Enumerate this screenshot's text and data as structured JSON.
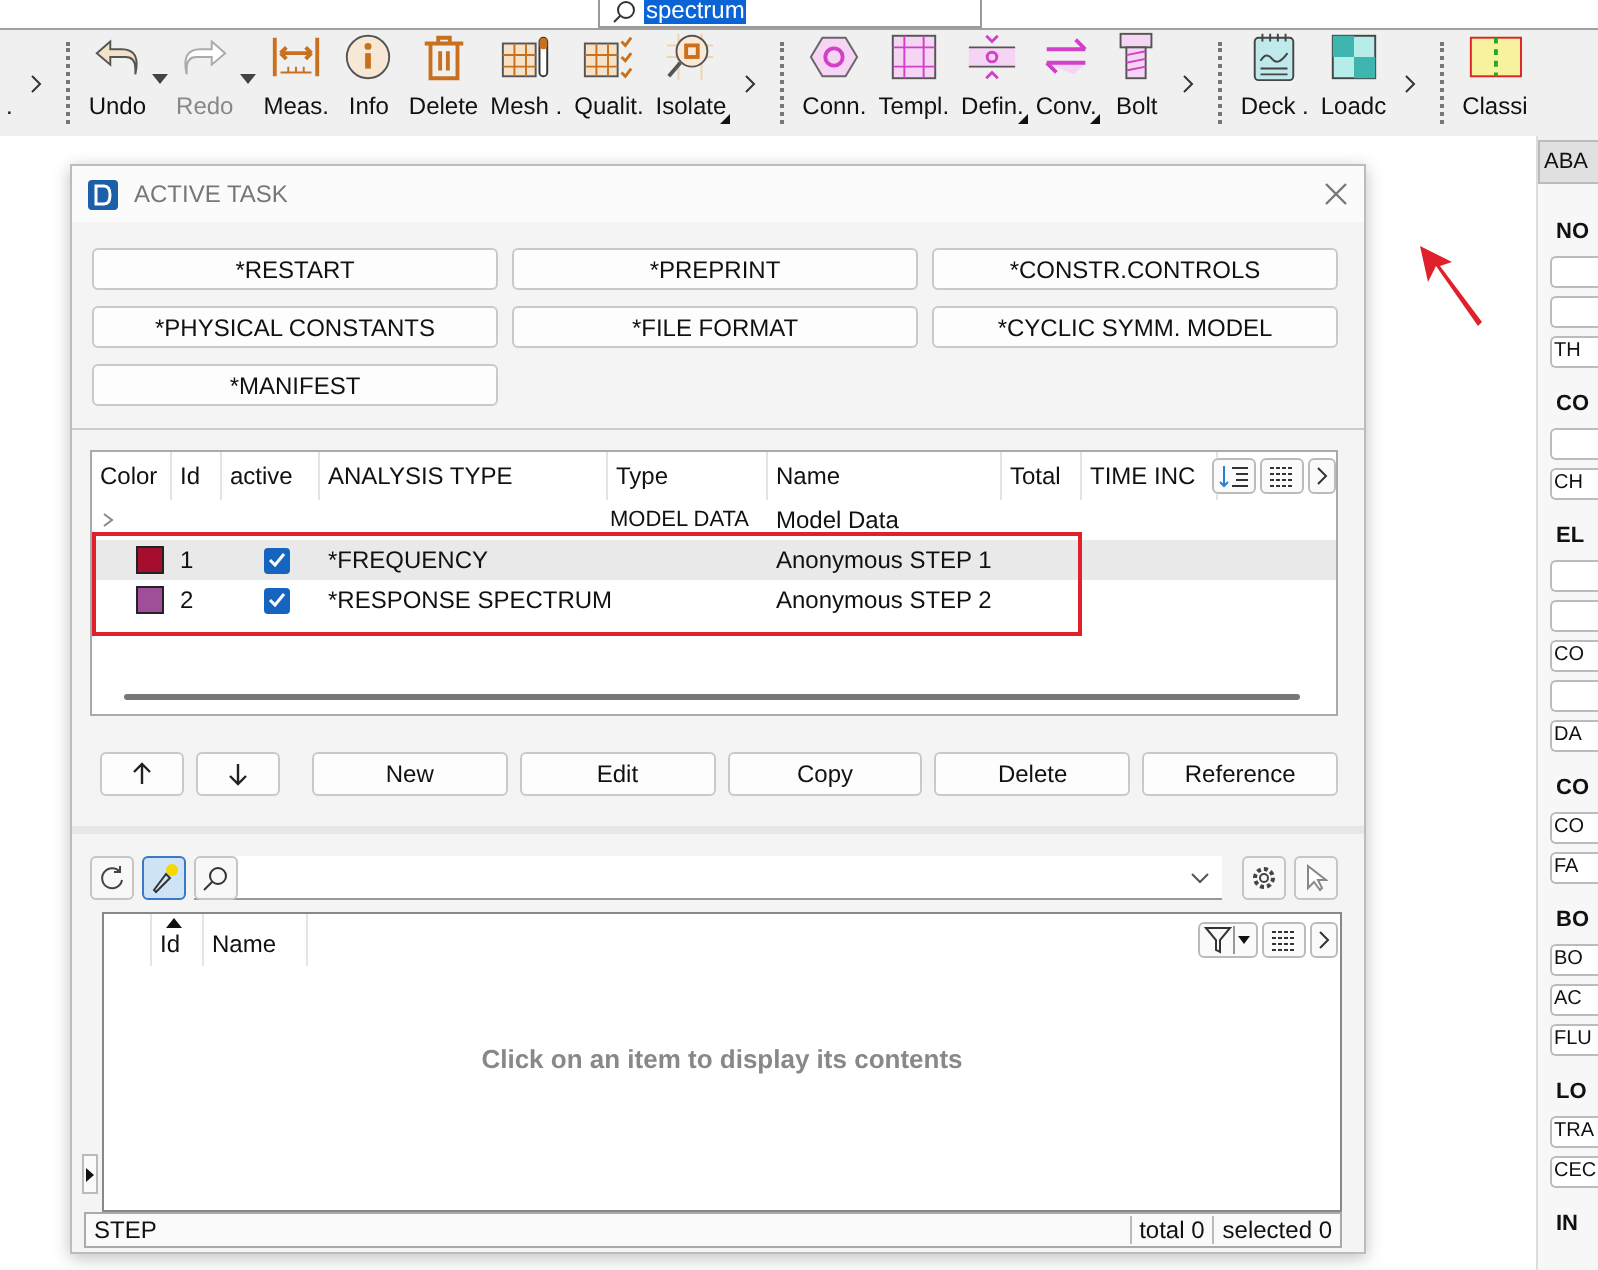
{
  "search": {
    "value": "spectrum",
    "selected": true
  },
  "toolbar": {
    "groups": [
      {
        "overflow": true,
        "items": [
          {
            "kind": "blank",
            "label": ".",
            "disabled": false,
            "side_menu": false,
            "corner_menu": false
          }
        ]
      },
      {
        "overflow": true,
        "items": [
          {
            "kind": "undo",
            "label": "Undo",
            "disabled": false,
            "side_menu": true,
            "corner_menu": false
          },
          {
            "kind": "redo",
            "label": "Redo",
            "disabled": true,
            "side_menu": true,
            "corner_menu": false
          },
          {
            "kind": "measure",
            "label": "Meas.",
            "disabled": false,
            "side_menu": false,
            "corner_menu": false
          },
          {
            "kind": "info",
            "label": "Info",
            "disabled": false,
            "side_menu": false,
            "corner_menu": false
          },
          {
            "kind": "trash",
            "label": "Delete",
            "disabled": false,
            "side_menu": false,
            "corner_menu": false
          },
          {
            "kind": "mesh",
            "label": "Mesh .",
            "disabled": false,
            "side_menu": false,
            "corner_menu": false
          },
          {
            "kind": "quality",
            "label": "Qualit.",
            "disabled": false,
            "side_menu": false,
            "corner_menu": false
          },
          {
            "kind": "isolate",
            "label": "Isolate",
            "disabled": false,
            "side_menu": false,
            "corner_menu": true
          }
        ]
      },
      {
        "overflow": true,
        "items": [
          {
            "kind": "hexnut",
            "label": "Conn.",
            "disabled": false,
            "side_menu": false,
            "corner_menu": false
          },
          {
            "kind": "template",
            "label": "Templ.",
            "disabled": false,
            "side_menu": false,
            "corner_menu": false
          },
          {
            "kind": "define",
            "label": "Defin.",
            "disabled": false,
            "side_menu": false,
            "corner_menu": true
          },
          {
            "kind": "convert",
            "label": "Conv.",
            "disabled": false,
            "side_menu": false,
            "corner_menu": true
          },
          {
            "kind": "bolt",
            "label": "Bolt",
            "disabled": false,
            "side_menu": false,
            "corner_menu": false
          }
        ]
      },
      {
        "overflow": true,
        "items": [
          {
            "kind": "deck",
            "label": "Deck .",
            "disabled": false,
            "side_menu": false,
            "corner_menu": false
          },
          {
            "kind": "loadcase",
            "label": "Loadc",
            "disabled": false,
            "side_menu": false,
            "corner_menu": false
          }
        ]
      },
      {
        "items": [
          {
            "kind": "classify",
            "label": "Classi",
            "disabled": false,
            "side_menu": false,
            "corner_menu": false
          }
        ]
      }
    ]
  },
  "dialog": {
    "title": "ACTIVE TASK",
    "keyword_buttons": [
      "*RESTART",
      "*PREPRINT",
      "*CONSTR.CONTROLS",
      "*PHYSICAL CONSTANTS",
      "*FILE FORMAT",
      "*CYCLIC SYMM. MODEL",
      "*MANIFEST"
    ],
    "table": {
      "columns": [
        "Color",
        "Id",
        "active",
        "ANALYSIS TYPE",
        "Type",
        "Name",
        "Total",
        "TIME INC"
      ],
      "rows": [
        {
          "kind": "group",
          "expanded": false,
          "selected": false,
          "type": "MODEL DATA",
          "name": "Model Data"
        },
        {
          "kind": "step",
          "selected": true,
          "color": "#a50f2d",
          "id": "1",
          "active": true,
          "analysis_type": "*FREQUENCY",
          "name": "Anonymous STEP 1"
        },
        {
          "kind": "step",
          "selected": false,
          "color": "#a04e9a",
          "id": "2",
          "active": true,
          "analysis_type": "*RESPONSE SPECTRUM",
          "name": "Anonymous STEP 2"
        }
      ]
    },
    "actions": [
      {
        "kind": "up"
      },
      {
        "kind": "down"
      },
      {
        "kind": "text",
        "label": "New"
      },
      {
        "kind": "text",
        "label": "Edit"
      },
      {
        "kind": "text",
        "label": "Copy"
      },
      {
        "kind": "text",
        "label": "Delete"
      },
      {
        "kind": "text",
        "label": "Reference"
      }
    ],
    "browser": {
      "highlight_on": true,
      "columns": [
        "Id",
        "Name"
      ],
      "sorted_ascending": true,
      "empty_message": "Click on an item to display its contents",
      "status": {
        "section": "STEP",
        "total": "total 0",
        "selected": "selected 0"
      }
    }
  },
  "side_panel": {
    "tab": "ABA",
    "items": [
      {
        "kind": "heading",
        "label": "NO"
      },
      {
        "kind": "button"
      },
      {
        "kind": "button"
      },
      {
        "kind": "button",
        "label": "TH"
      },
      {
        "kind": "heading",
        "label": "CO"
      },
      {
        "kind": "button"
      },
      {
        "kind": "button",
        "label": "CH"
      },
      {
        "kind": "heading",
        "label": "EL"
      },
      {
        "kind": "button"
      },
      {
        "kind": "button"
      },
      {
        "kind": "button",
        "label": "CO"
      },
      {
        "kind": "button"
      },
      {
        "kind": "button",
        "label": "DA"
      },
      {
        "kind": "heading",
        "label": "CO"
      },
      {
        "kind": "button",
        "label": "CO"
      },
      {
        "kind": "button",
        "label": "FA"
      },
      {
        "kind": "heading",
        "label": "BO"
      },
      {
        "kind": "button",
        "label": "BO"
      },
      {
        "kind": "button",
        "label": "AC"
      },
      {
        "kind": "button",
        "label": "FLU"
      },
      {
        "kind": "heading",
        "label": "LO"
      },
      {
        "kind": "button",
        "label": "TRA"
      },
      {
        "kind": "button",
        "label": "CEC"
      },
      {
        "kind": "heading",
        "label": "IN"
      }
    ]
  }
}
